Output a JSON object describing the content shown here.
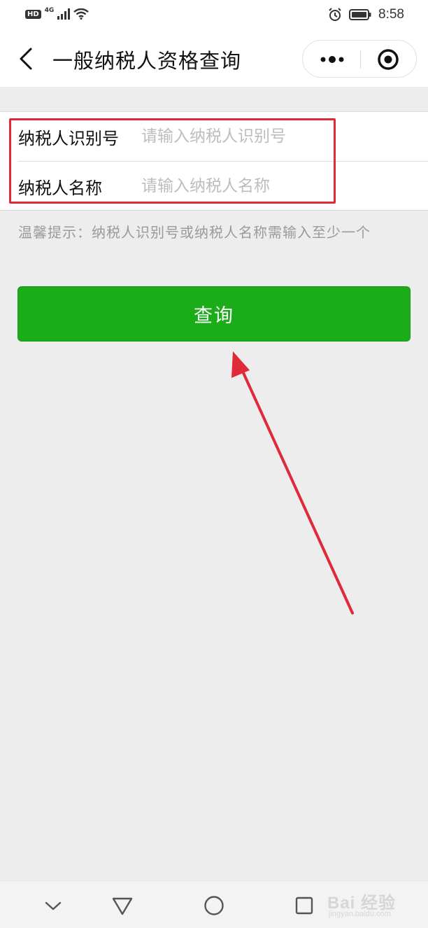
{
  "status_bar": {
    "hd_label": "HD",
    "network_label": "4G",
    "time": "8:58",
    "icons": [
      "signal-icon",
      "wifi-icon",
      "alarm-icon",
      "battery-icon"
    ]
  },
  "nav": {
    "title": "一般纳税人资格查询",
    "back_icon": "chevron-left-icon",
    "more_icon": "more-dots-icon",
    "close_icon": "target-circle-icon"
  },
  "form": {
    "taxpayer_id": {
      "label": "纳税人识别号",
      "value": "",
      "placeholder": "请输入纳税人识别号"
    },
    "taxpayer_name": {
      "label": "纳税人名称",
      "value": "",
      "placeholder": "请输入纳税人名称"
    }
  },
  "hint": "温馨提示：纳税人识别号或纳税人名称需输入至少一个",
  "query_button": {
    "label": "查询",
    "color": "#1aad19"
  },
  "annotation": {
    "highlight_color": "#e02a3a",
    "arrow_color": "#e02a3a"
  },
  "bottom_nav": {
    "icons": [
      "collapse-chevron-icon",
      "back-triangle-icon",
      "home-circle-icon",
      "recent-square-icon"
    ]
  },
  "watermark": {
    "main": "Bai 经验",
    "sub": "jingyan.baidu.com"
  }
}
